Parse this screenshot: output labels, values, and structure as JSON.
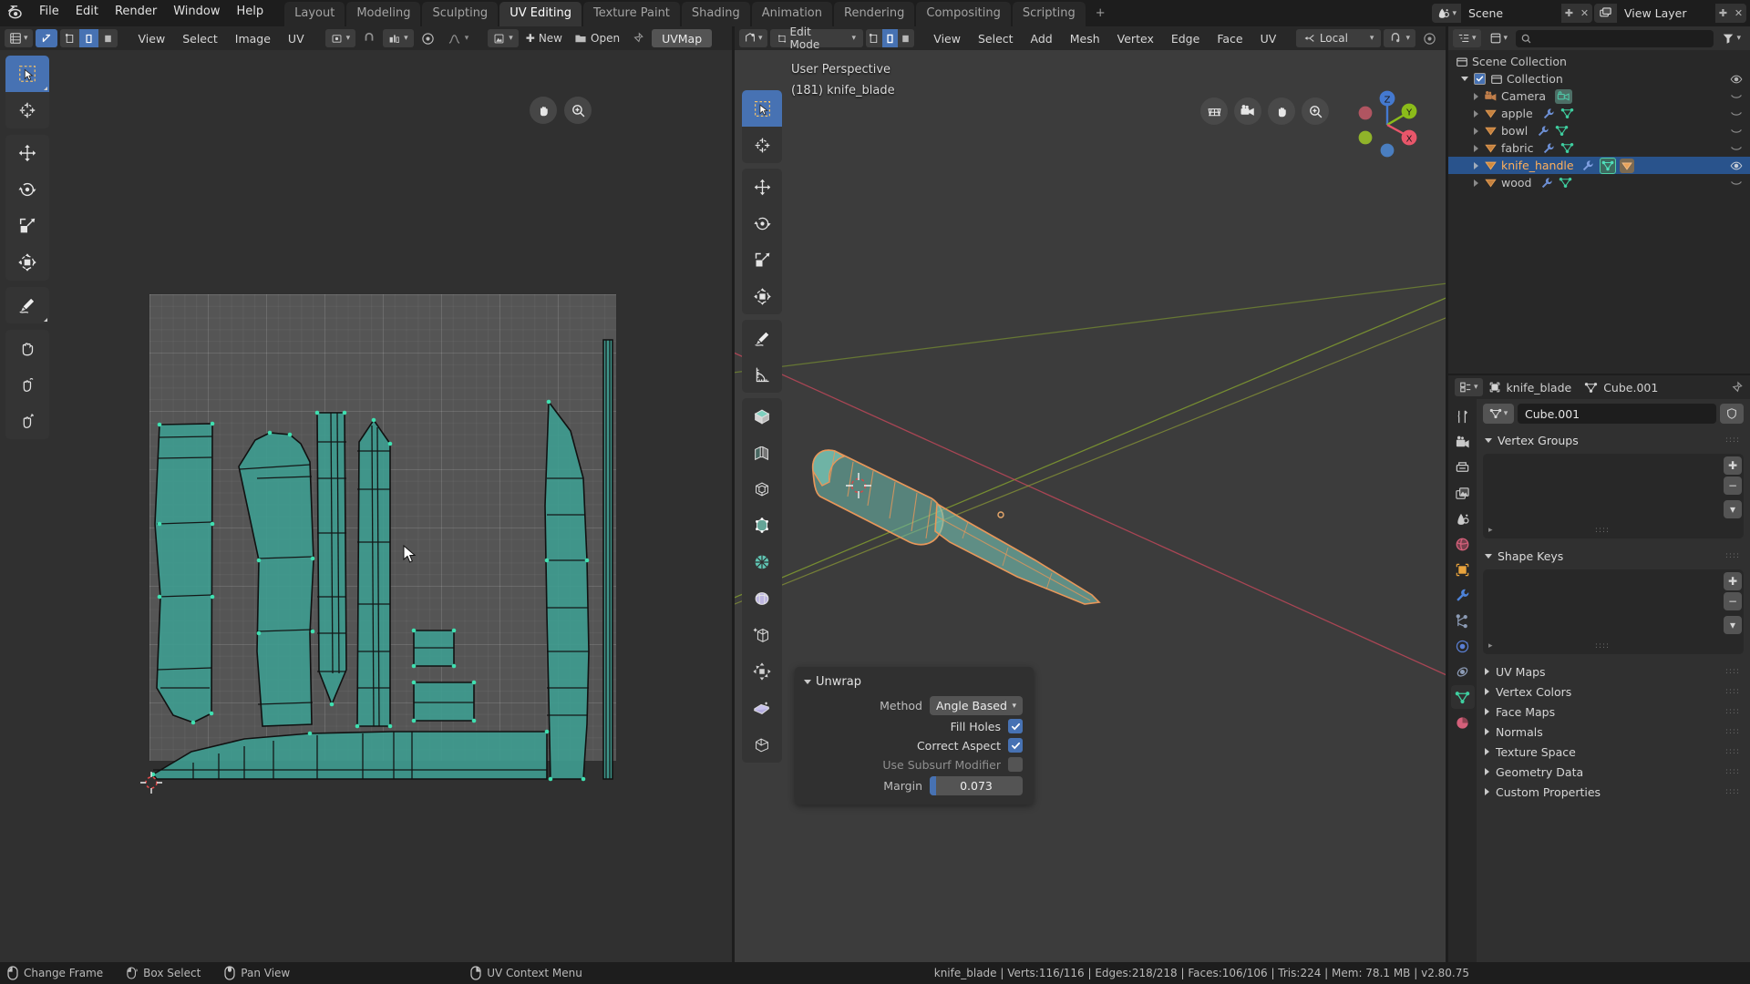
{
  "app": {
    "title": "Blender",
    "version_status": "knife_blade | Verts:116/116 | Edges:218/218 | Faces:106/106 | Tris:224 | Mem: 78.1 MB | v2.80.75"
  },
  "topbar": {
    "logo_icon": "blender-logo-icon",
    "menus": [
      "File",
      "Edit",
      "Render",
      "Window",
      "Help"
    ],
    "workspace_tabs": [
      {
        "label": "Layout",
        "active": false
      },
      {
        "label": "Modeling",
        "active": false
      },
      {
        "label": "Sculpting",
        "active": false
      },
      {
        "label": "UV Editing",
        "active": true
      },
      {
        "label": "Texture Paint",
        "active": false
      },
      {
        "label": "Shading",
        "active": false
      },
      {
        "label": "Animation",
        "active": false
      },
      {
        "label": "Rendering",
        "active": false
      },
      {
        "label": "Compositing",
        "active": false
      },
      {
        "label": "Scripting",
        "active": false
      },
      {
        "label": "+",
        "active": false
      }
    ],
    "scene_name": "Scene",
    "view_layer_name": "View Layer",
    "scene_icon": "scene-icon",
    "view_layer_icon": "view-layer-icon",
    "new_scene_icon": "new-scene-icon",
    "unlink_icon": "unlink-icon"
  },
  "uv_editor": {
    "editor_type_icon": "uv-editor-icon",
    "mode_icon": "uv-sync-icon",
    "select_modes": [
      "vertex-select-icon",
      "edge-select-icon",
      "face-select-icon",
      "island-select-icon"
    ],
    "active_select_mode": 1,
    "menus": [
      "View",
      "Select",
      "Image",
      "UV"
    ],
    "pivot_icon": "pivot-point-icon",
    "snap_icon": "snap-magnet-icon",
    "snap_target_icon": "snap-target-icon",
    "proportional_icon": "proportional-edit-icon",
    "falloff_icon": "falloff-curve-icon",
    "image_browse_icon": "image-browse-icon",
    "new_label": "New",
    "open_label": "Open",
    "pin_icon": "pin-icon",
    "uvmap_label": "UVMap",
    "overlay_buttons": [
      "hand-pan-icon",
      "zoom-icon"
    ],
    "toolbar": [
      {
        "name": "tweak-tool",
        "icon": "select-box-cursor-icon",
        "active": true
      },
      {
        "name": "cursor-tool",
        "icon": "cursor-2d-icon",
        "active": false
      },
      {
        "name": "move-tool",
        "icon": "move-arrows-icon",
        "active": false
      },
      {
        "name": "rotate-tool",
        "icon": "rotate-icon",
        "active": false
      },
      {
        "name": "scale-tool",
        "icon": "scale-icon",
        "active": false
      },
      {
        "name": "transform-tool",
        "icon": "transform-icon",
        "active": false
      },
      {
        "name": "annotate-tool",
        "icon": "pencil-annotate-icon",
        "active": false
      },
      {
        "name": "grab-tool",
        "icon": "hand-grab-icon",
        "active": false
      },
      {
        "name": "relax-tool",
        "icon": "hand-relax-icon",
        "active": false
      },
      {
        "name": "pinch-tool",
        "icon": "hand-pinch-icon",
        "active": false
      }
    ]
  },
  "viewport_3d": {
    "editor_type_icon": "viewport-3d-icon",
    "mode_label": "Edit Mode",
    "mode_icon": "edit-mode-icon",
    "mesh_select_modes": [
      "vertex-mode-icon",
      "edge-mode-icon",
      "face-mode-icon"
    ],
    "active_mesh_select_mode": 1,
    "menus": [
      "View",
      "Select",
      "Add",
      "Mesh",
      "Vertex",
      "Edge",
      "Face",
      "UV"
    ],
    "orientation_label": "Local",
    "orientation_icon": "transform-orientation-icon",
    "snap_icon": "snap-magnet-icon",
    "proportional_icon": "proportional-edit-icon",
    "overlay_text_line1": "User Perspective",
    "overlay_text_line2": "(181) knife_blade",
    "nav_buttons": [
      "grid-view-icon",
      "camera-view-icon",
      "hand-pan-icon",
      "zoom-icon"
    ],
    "gizmo_axes": [
      {
        "label": "Z",
        "color": "#4479d0"
      },
      {
        "label": "Y",
        "color": "#8bbc1a"
      },
      {
        "label": "X",
        "color": "#e8566a"
      }
    ],
    "toolbar": [
      {
        "name": "tweak-tool",
        "icon": "select-box-cursor-icon",
        "active": true
      },
      {
        "name": "cursor-tool",
        "icon": "cursor-3d-icon",
        "active": false
      },
      {
        "name": "move-tool",
        "icon": "move-arrows-icon",
        "active": false
      },
      {
        "name": "rotate-tool",
        "icon": "rotate-icon",
        "active": false
      },
      {
        "name": "scale-tool",
        "icon": "scale-icon",
        "active": false
      },
      {
        "name": "transform-tool",
        "icon": "transform-icon",
        "active": false
      },
      {
        "name": "annotate-tool",
        "icon": "pencil-annotate-icon",
        "active": false
      },
      {
        "name": "measure-tool",
        "icon": "measure-ruler-icon",
        "active": false
      },
      {
        "name": "add-cube-tool",
        "icon": "add-cube-icon",
        "active": false
      },
      {
        "name": "extrude-region-tool",
        "icon": "extrude-region-icon",
        "active": false
      },
      {
        "name": "inset-faces-tool",
        "icon": "inset-faces-icon",
        "active": false
      },
      {
        "name": "bevel-tool",
        "icon": "bevel-icon",
        "active": false
      },
      {
        "name": "loop-cut-tool",
        "icon": "loop-cut-icon",
        "active": false
      },
      {
        "name": "knife-tool",
        "icon": "knife-icon",
        "active": false
      },
      {
        "name": "poly-build-tool",
        "icon": "poly-build-icon",
        "active": false
      },
      {
        "name": "spin-tool",
        "icon": "spin-icon",
        "active": false
      },
      {
        "name": "smooth-tool",
        "icon": "smooth-icon",
        "active": false
      },
      {
        "name": "shrink-fatten-tool",
        "icon": "shrink-fatten-icon",
        "active": false
      },
      {
        "name": "shear-tool",
        "icon": "shear-icon",
        "active": false
      }
    ]
  },
  "operator_panel": {
    "title": "Unwrap",
    "method_label": "Method",
    "method_value": "Angle Based",
    "fill_holes_label": "Fill Holes",
    "fill_holes_checked": true,
    "correct_aspect_label": "Correct Aspect",
    "correct_aspect_checked": true,
    "use_subsurf_label": "Use Subsurf Modifier",
    "use_subsurf_checked": false,
    "margin_label": "Margin",
    "margin_value": "0.073"
  },
  "outliner": {
    "display_mode_icon": "outliner-display-icon",
    "filter_icon": "filter-icon",
    "search_placeholder": "",
    "search_icon": "search-icon",
    "root_label": "Scene Collection",
    "root_icon": "collection-icon",
    "items": [
      {
        "label": "Collection",
        "icon": "collection-icon",
        "indent": 1,
        "selected": false,
        "checkbox": true,
        "expanded": true,
        "visibility_icon": "eye-open-icon",
        "type_icons": []
      },
      {
        "label": "Camera",
        "icon": "camera-data-icon",
        "indent": 2,
        "selected": false,
        "checkbox": false,
        "expanded": false,
        "visibility_icon": "eye-closed-icon",
        "type_icons": [
          "camera-icon"
        ]
      },
      {
        "label": "apple",
        "icon": "mesh-object-icon",
        "indent": 2,
        "selected": false,
        "checkbox": false,
        "expanded": false,
        "visibility_icon": "eye-closed-icon",
        "type_icons": [
          "modifier-wrench-icon",
          "mesh-data-icon"
        ]
      },
      {
        "label": "bowl",
        "icon": "mesh-object-icon",
        "indent": 2,
        "selected": false,
        "checkbox": false,
        "expanded": false,
        "visibility_icon": "eye-closed-icon",
        "type_icons": [
          "modifier-wrench-icon",
          "mesh-data-icon"
        ]
      },
      {
        "label": "fabric",
        "icon": "mesh-object-icon",
        "indent": 2,
        "selected": false,
        "checkbox": false,
        "expanded": false,
        "visibility_icon": "eye-closed-icon",
        "type_icons": [
          "modifier-wrench-icon",
          "mesh-data-icon"
        ]
      },
      {
        "label": "knife_handle",
        "icon": "mesh-object-icon",
        "indent": 2,
        "selected": true,
        "checkbox": false,
        "expanded": false,
        "visibility_icon": "eye-open-icon",
        "type_icons": [
          "modifier-wrench-icon",
          "mesh-data-icon",
          "mesh-object-icon"
        ]
      },
      {
        "label": "wood",
        "icon": "mesh-object-icon",
        "indent": 2,
        "selected": false,
        "checkbox": false,
        "expanded": false,
        "visibility_icon": "eye-closed-icon",
        "type_icons": [
          "modifier-wrench-icon",
          "mesh-data-icon"
        ]
      }
    ]
  },
  "properties": {
    "editor_type_icon": "properties-editor-icon",
    "breadcrumb_object": "knife_blade",
    "breadcrumb_object_icon": "object-icon",
    "breadcrumb_data": "Cube.001",
    "breadcrumb_data_icon": "mesh-data-icon",
    "pin_icon": "pin-icon",
    "datablock_name": "Cube.001",
    "datablock_icon": "mesh-data-icon",
    "shield_icon": "fake-user-shield-icon",
    "tabs": [
      {
        "name": "tool-tab",
        "icon": "tool-wrench-screwdriver-icon",
        "color": "#c9c9c9",
        "active": false
      },
      {
        "name": "render-tab",
        "icon": "render-camera-icon",
        "color": "#c9c9c9",
        "active": false
      },
      {
        "name": "output-tab",
        "icon": "output-printer-icon",
        "color": "#c9c9c9",
        "active": false
      },
      {
        "name": "view-layer-tab",
        "icon": "view-layer-images-icon",
        "color": "#c9c9c9",
        "active": false
      },
      {
        "name": "scene-tab",
        "icon": "scene-cone-icon",
        "color": "#c9c9c9",
        "active": false
      },
      {
        "name": "world-tab",
        "icon": "world-globe-icon",
        "color": "#d4607a",
        "active": false
      },
      {
        "name": "object-tab",
        "icon": "object-square-icon",
        "color": "#e8a33d",
        "active": false
      },
      {
        "name": "modifier-tab",
        "icon": "modifier-wrench-icon",
        "color": "#4d82d8",
        "active": false
      },
      {
        "name": "particles-tab",
        "icon": "particles-icon",
        "color": "#8c9bb5",
        "active": false
      },
      {
        "name": "physics-tab",
        "icon": "physics-orbit-icon",
        "color": "#5a7fd4",
        "active": false
      },
      {
        "name": "constraints-tab",
        "icon": "constraints-icon",
        "color": "#8c9bb5",
        "active": false
      },
      {
        "name": "data-tab",
        "icon": "mesh-data-icon",
        "color": "#3fcfa0",
        "active": true
      },
      {
        "name": "material-tab",
        "icon": "material-sphere-icon",
        "color": "#d4607a",
        "active": false
      }
    ],
    "panels": [
      {
        "label": "Vertex Groups",
        "expanded": true,
        "type": "list"
      },
      {
        "label": "Shape Keys",
        "expanded": true,
        "type": "list"
      },
      {
        "label": "UV Maps",
        "expanded": false,
        "type": "collapsed"
      },
      {
        "label": "Vertex Colors",
        "expanded": false,
        "type": "collapsed"
      },
      {
        "label": "Face Maps",
        "expanded": false,
        "type": "collapsed"
      },
      {
        "label": "Normals",
        "expanded": false,
        "type": "collapsed"
      },
      {
        "label": "Texture Space",
        "expanded": false,
        "type": "collapsed"
      },
      {
        "label": "Geometry Data",
        "expanded": false,
        "type": "collapsed"
      },
      {
        "label": "Custom Properties",
        "expanded": false,
        "type": "collapsed"
      }
    ]
  },
  "statusbar": {
    "hints": [
      {
        "icon": "mouse-left-icon",
        "label": "Change Frame"
      },
      {
        "icon": "mouse-left-drag-icon",
        "label": "Box Select"
      },
      {
        "icon": "mouse-middle-icon",
        "label": "Pan View"
      },
      {
        "icon": "mouse-right-icon",
        "label": "UV Context Menu"
      }
    ],
    "info": "knife_blade | Verts:116/116 | Edges:218/218 | Faces:106/106 | Tris:224 | Mem: 78.1 MB | v2.80.75"
  },
  "colors": {
    "accent_blue": "#4772b3",
    "uv_face_fill": "#3f9b8f",
    "uv_edge": "#1b1b1b",
    "uv_vertex": "#3fe0b0",
    "mesh_selected_orange": "#ed9f5a",
    "background_dark": "#1d1d1d",
    "panel_bg": "#303030",
    "header_bg": "#282828"
  }
}
